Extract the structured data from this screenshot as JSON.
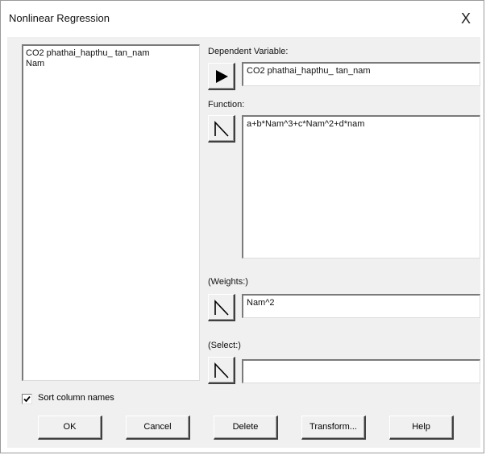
{
  "window": {
    "title": "Nonlinear Regression",
    "close_glyph": "X"
  },
  "column_list": {
    "items": [
      "CO2 phathai_hapthu_ tan_nam",
      "Nam"
    ]
  },
  "dependent": {
    "label": "Dependent Variable:",
    "value": "CO2 phathai_hapthu_ tan_nam"
  },
  "function": {
    "label": "Function:",
    "value": "a+b*Nam^3+c*Nam^2+d*nam"
  },
  "weights": {
    "label": "(Weights:)",
    "value": "Nam^2"
  },
  "select": {
    "label": "(Select:)",
    "value": ""
  },
  "sort": {
    "label": "Sort column names",
    "checked": true
  },
  "buttons": {
    "ok": "OK",
    "cancel": "Cancel",
    "delete": "Delete",
    "transform": "Transform...",
    "help": "Help"
  },
  "icons": {
    "dependent_button": "arrow-right-icon",
    "function_button": "function-insert-icon",
    "weights_button": "function-insert-icon",
    "select_button": "function-insert-icon",
    "close": "close-icon",
    "checkmark": "checkmark-icon"
  }
}
